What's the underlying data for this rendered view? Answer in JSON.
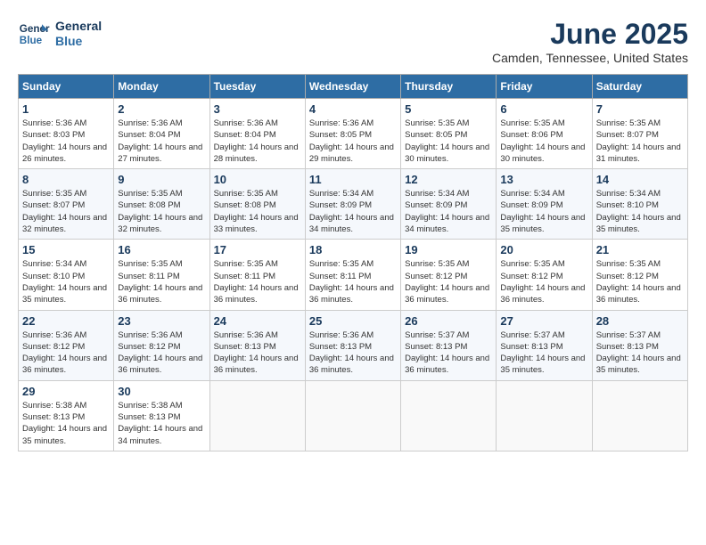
{
  "logo": {
    "line1": "General",
    "line2": "Blue"
  },
  "title": "June 2025",
  "location": "Camden, Tennessee, United States",
  "days_of_week": [
    "Sunday",
    "Monday",
    "Tuesday",
    "Wednesday",
    "Thursday",
    "Friday",
    "Saturday"
  ],
  "weeks": [
    [
      {
        "day": "1",
        "sunrise": "5:36 AM",
        "sunset": "8:03 PM",
        "daylight": "14 hours and 26 minutes."
      },
      {
        "day": "2",
        "sunrise": "5:36 AM",
        "sunset": "8:04 PM",
        "daylight": "14 hours and 27 minutes."
      },
      {
        "day": "3",
        "sunrise": "5:36 AM",
        "sunset": "8:04 PM",
        "daylight": "14 hours and 28 minutes."
      },
      {
        "day": "4",
        "sunrise": "5:36 AM",
        "sunset": "8:05 PM",
        "daylight": "14 hours and 29 minutes."
      },
      {
        "day": "5",
        "sunrise": "5:35 AM",
        "sunset": "8:05 PM",
        "daylight": "14 hours and 30 minutes."
      },
      {
        "day": "6",
        "sunrise": "5:35 AM",
        "sunset": "8:06 PM",
        "daylight": "14 hours and 30 minutes."
      },
      {
        "day": "7",
        "sunrise": "5:35 AM",
        "sunset": "8:07 PM",
        "daylight": "14 hours and 31 minutes."
      }
    ],
    [
      {
        "day": "8",
        "sunrise": "5:35 AM",
        "sunset": "8:07 PM",
        "daylight": "14 hours and 32 minutes."
      },
      {
        "day": "9",
        "sunrise": "5:35 AM",
        "sunset": "8:08 PM",
        "daylight": "14 hours and 32 minutes."
      },
      {
        "day": "10",
        "sunrise": "5:35 AM",
        "sunset": "8:08 PM",
        "daylight": "14 hours and 33 minutes."
      },
      {
        "day": "11",
        "sunrise": "5:34 AM",
        "sunset": "8:09 PM",
        "daylight": "14 hours and 34 minutes."
      },
      {
        "day": "12",
        "sunrise": "5:34 AM",
        "sunset": "8:09 PM",
        "daylight": "14 hours and 34 minutes."
      },
      {
        "day": "13",
        "sunrise": "5:34 AM",
        "sunset": "8:09 PM",
        "daylight": "14 hours and 35 minutes."
      },
      {
        "day": "14",
        "sunrise": "5:34 AM",
        "sunset": "8:10 PM",
        "daylight": "14 hours and 35 minutes."
      }
    ],
    [
      {
        "day": "15",
        "sunrise": "5:34 AM",
        "sunset": "8:10 PM",
        "daylight": "14 hours and 35 minutes."
      },
      {
        "day": "16",
        "sunrise": "5:35 AM",
        "sunset": "8:11 PM",
        "daylight": "14 hours and 36 minutes."
      },
      {
        "day": "17",
        "sunrise": "5:35 AM",
        "sunset": "8:11 PM",
        "daylight": "14 hours and 36 minutes."
      },
      {
        "day": "18",
        "sunrise": "5:35 AM",
        "sunset": "8:11 PM",
        "daylight": "14 hours and 36 minutes."
      },
      {
        "day": "19",
        "sunrise": "5:35 AM",
        "sunset": "8:12 PM",
        "daylight": "14 hours and 36 minutes."
      },
      {
        "day": "20",
        "sunrise": "5:35 AM",
        "sunset": "8:12 PM",
        "daylight": "14 hours and 36 minutes."
      },
      {
        "day": "21",
        "sunrise": "5:35 AM",
        "sunset": "8:12 PM",
        "daylight": "14 hours and 36 minutes."
      }
    ],
    [
      {
        "day": "22",
        "sunrise": "5:36 AM",
        "sunset": "8:12 PM",
        "daylight": "14 hours and 36 minutes."
      },
      {
        "day": "23",
        "sunrise": "5:36 AM",
        "sunset": "8:12 PM",
        "daylight": "14 hours and 36 minutes."
      },
      {
        "day": "24",
        "sunrise": "5:36 AM",
        "sunset": "8:13 PM",
        "daylight": "14 hours and 36 minutes."
      },
      {
        "day": "25",
        "sunrise": "5:36 AM",
        "sunset": "8:13 PM",
        "daylight": "14 hours and 36 minutes."
      },
      {
        "day": "26",
        "sunrise": "5:37 AM",
        "sunset": "8:13 PM",
        "daylight": "14 hours and 36 minutes."
      },
      {
        "day": "27",
        "sunrise": "5:37 AM",
        "sunset": "8:13 PM",
        "daylight": "14 hours and 35 minutes."
      },
      {
        "day": "28",
        "sunrise": "5:37 AM",
        "sunset": "8:13 PM",
        "daylight": "14 hours and 35 minutes."
      }
    ],
    [
      {
        "day": "29",
        "sunrise": "5:38 AM",
        "sunset": "8:13 PM",
        "daylight": "14 hours and 35 minutes."
      },
      {
        "day": "30",
        "sunrise": "5:38 AM",
        "sunset": "8:13 PM",
        "daylight": "14 hours and 34 minutes."
      },
      null,
      null,
      null,
      null,
      null
    ]
  ]
}
